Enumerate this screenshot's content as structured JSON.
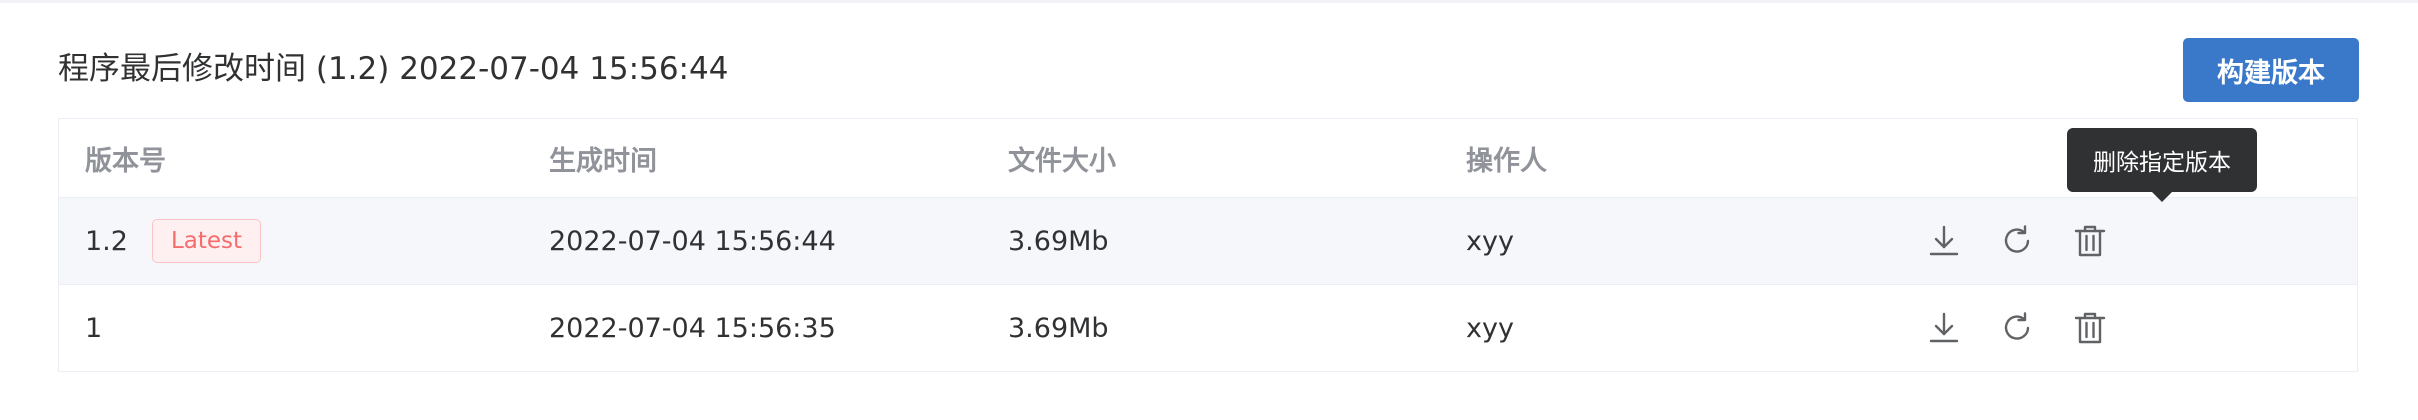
{
  "header": {
    "title": "程序最后修改时间 (1.2) 2022-07-04 15:56:44",
    "build_button": "构建版本"
  },
  "table": {
    "columns": [
      "版本号",
      "生成时间",
      "文件大小",
      "操作人"
    ],
    "rows": [
      {
        "version": "1.2",
        "tag": "Latest",
        "time": "2022-07-04 15:56:44",
        "size": "3.69Mb",
        "operator": "xyy"
      },
      {
        "version": "1",
        "tag": "",
        "time": "2022-07-04 15:56:35",
        "size": "3.69Mb",
        "operator": "xyy"
      }
    ],
    "actions": [
      "download-icon",
      "refresh-icon",
      "trash-icon"
    ]
  },
  "tooltip": {
    "text": "删除指定版本"
  },
  "colors": {
    "primary": "#3a78c9",
    "tag_text": "#f56c6c",
    "tag_bg": "#fef0f0",
    "tooltip_bg": "#303133",
    "row_highlight": "#f5f7fa"
  }
}
